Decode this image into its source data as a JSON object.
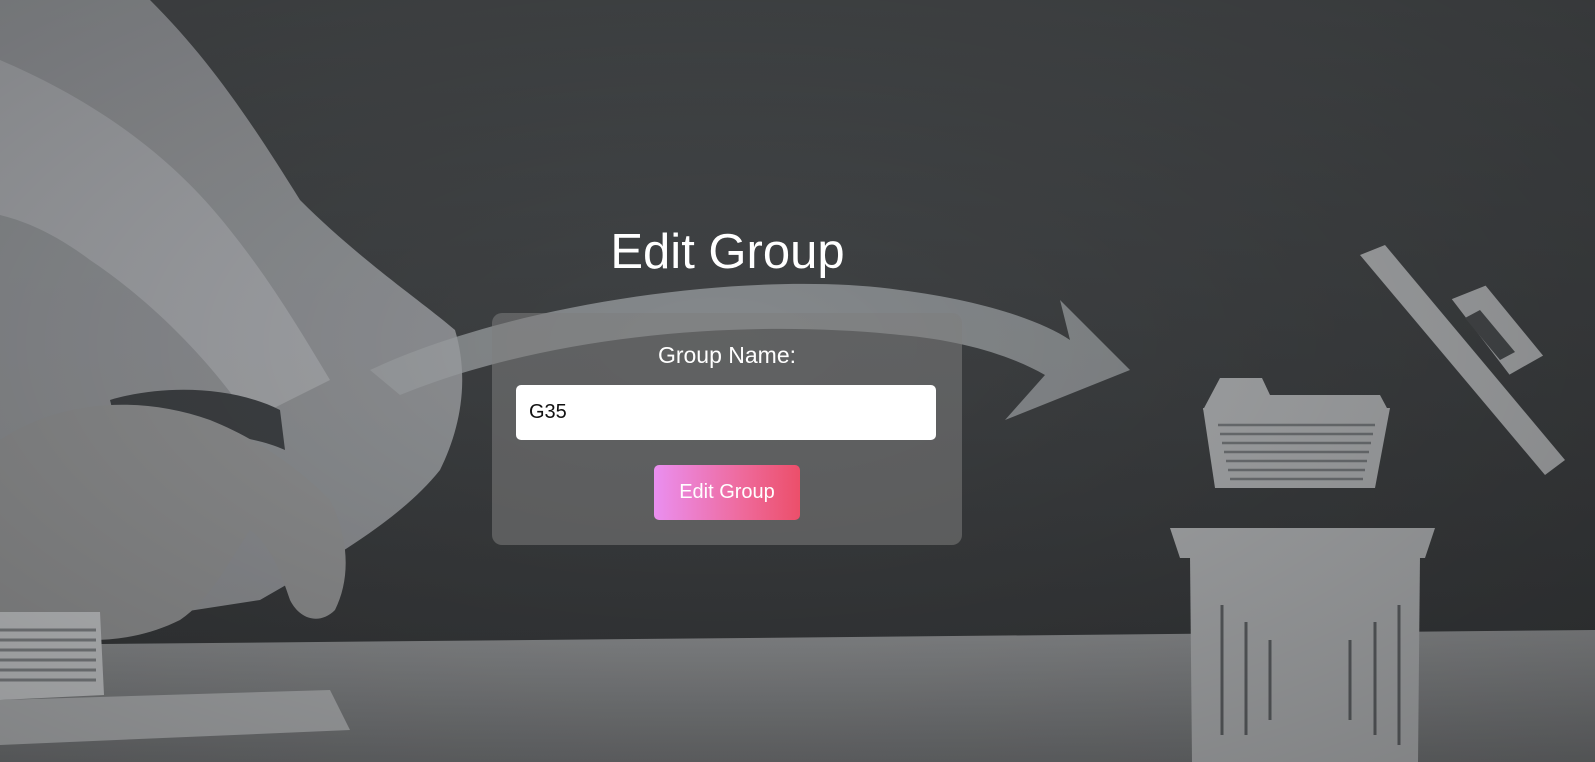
{
  "page": {
    "title": "Edit Group"
  },
  "form": {
    "group_name_label": "Group Name:",
    "group_name_value": "G35",
    "submit_label": "Edit Group"
  },
  "colors": {
    "button_gradient_start": "#ea8ff0",
    "button_gradient_end": "#ec4f6a",
    "overlay": "#3a3d40"
  },
  "background": {
    "icons": [
      "hand-pointing-icon",
      "arrow-icon",
      "folder-icon",
      "trash-bin-icon",
      "trash-lid-icon"
    ]
  }
}
